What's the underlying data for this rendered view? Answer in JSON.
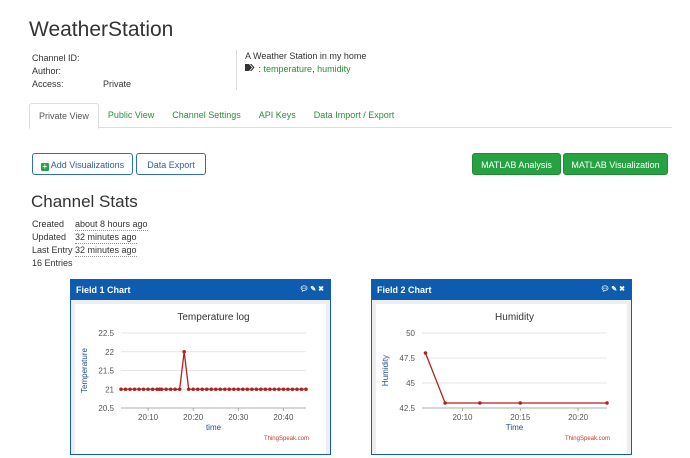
{
  "channel": {
    "title": "WeatherStation",
    "meta": [
      {
        "label": "Channel ID:",
        "value": ""
      },
      {
        "label": "Author:",
        "value": ""
      },
      {
        "label": "Access:",
        "value": "Private"
      }
    ],
    "description": "A Weather Station in my home",
    "tags": [
      "temperature",
      "humidity"
    ],
    "tags_sep": ", ",
    "tags_prefix": ": "
  },
  "tabs": [
    "Private View",
    "Public View",
    "Channel Settings",
    "API Keys",
    "Data Import / Export"
  ],
  "buttons": {
    "add_visualizations": "Add Visualizations",
    "data_export": "Data Export",
    "matlab_analysis": "MATLAB Analysis",
    "matlab_visualization": "MATLAB Visualization"
  },
  "stats": {
    "title": "Channel Stats",
    "rows": [
      {
        "label": "Created",
        "value": "about 8 hours ago"
      },
      {
        "label": "Updated",
        "value": "32 minutes ago"
      },
      {
        "label": "Last Entry",
        "value": "32 minutes ago"
      }
    ],
    "entries": "16 Entries"
  },
  "panels": [
    {
      "title": "Field 1 Chart",
      "icons": "comment-icon, pencil-icon, close-icon"
    },
    {
      "title": "Field 2 Chart",
      "icons": "comment-icon, pencil-icon, close-icon"
    }
  ],
  "colors": {
    "accent_green": "#27a243",
    "panel_blue": "#0d5cb0",
    "series_red": "#b22222"
  },
  "chart_data": [
    {
      "type": "line",
      "title": "Temperature log",
      "xlabel": "time",
      "ylabel": "Temperature",
      "credit": "ThingSpeak.com",
      "yticks": [
        20.5,
        21,
        21.5,
        22,
        22.5
      ],
      "ylim": [
        20.5,
        22.5
      ],
      "xticks": [
        {
          "label": "20:10",
          "x": 10
        },
        {
          "label": "20:20",
          "x": 20
        },
        {
          "label": "20:30",
          "x": 30
        },
        {
          "label": "20:40",
          "x": 40
        }
      ],
      "xlim": [
        4,
        45
      ],
      "x": [
        4,
        5,
        6,
        7,
        8,
        9,
        10,
        11,
        12,
        12.5,
        13,
        14,
        15,
        16,
        17,
        18,
        19,
        20,
        21,
        22,
        23,
        24,
        25,
        26,
        27,
        28,
        29,
        30,
        31,
        32,
        33,
        34,
        35,
        36,
        37,
        38,
        39,
        40,
        41,
        42,
        43,
        44,
        45
      ],
      "y": [
        21,
        21,
        21,
        21,
        21,
        21,
        21,
        21,
        21,
        21,
        21,
        21,
        21,
        21,
        21,
        22,
        21,
        21,
        21,
        21,
        21,
        21,
        21,
        21,
        21,
        21,
        21,
        21,
        21,
        21,
        21,
        21,
        21,
        21,
        21,
        21,
        21,
        21,
        21,
        21,
        21,
        21,
        21
      ]
    },
    {
      "type": "line",
      "title": "Humidity",
      "xlabel": "Time",
      "ylabel": "Humidity",
      "credit": "ThingSpeak.com",
      "yticks": [
        42.5,
        45,
        47.5,
        50
      ],
      "ylim": [
        42.5,
        50
      ],
      "xticks": [
        {
          "label": "20:10",
          "x": 10
        },
        {
          "label": "20:15",
          "x": 15
        },
        {
          "label": "20:20",
          "x": 20
        }
      ],
      "xlim": [
        6.5,
        22.5
      ],
      "x": [
        6.8,
        8.5,
        11.5,
        15,
        22.5
      ],
      "y": [
        48,
        43,
        43,
        43,
        43
      ]
    }
  ]
}
